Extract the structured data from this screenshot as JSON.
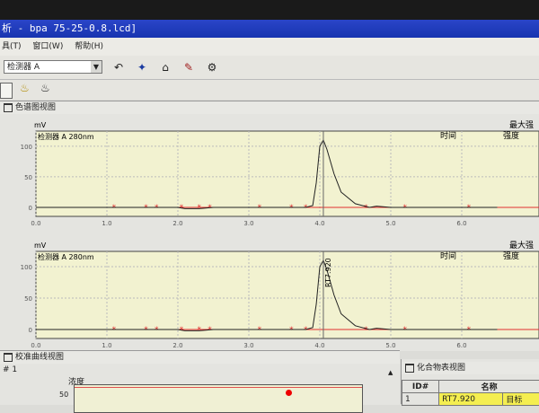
{
  "window": {
    "title": "析 - bpa 75-25-0.8.lcd]"
  },
  "menu": [
    "具(T)",
    "窗口(W)",
    "帮助(H)"
  ],
  "toolbar": {
    "detector_select": "检测器 A",
    "icons": [
      "undo-icon",
      "peak-icon",
      "integrate-icon",
      "edit-icon",
      "settings-icon"
    ]
  },
  "chromatogram_panel": {
    "title": "色谱图视图"
  },
  "charts": [
    {
      "detector_label": "检测器 A 280nm",
      "unit": "mV",
      "col_time": "时间",
      "col_intensity": "强度",
      "max_label": "最大强"
    },
    {
      "detector_label": "检测器 A 280nm",
      "unit": "mV",
      "col_time": "时间",
      "col_intensity": "强度",
      "max_label": "最大强",
      "peak_label": "RT7.920"
    }
  ],
  "chart_data": {
    "type": "line",
    "xlim": [
      0,
      6.5
    ],
    "ylim": [
      -5,
      125
    ],
    "xticks": [
      "0.0",
      "1.0",
      "2.0",
      "3.0",
      "4.0",
      "5.0",
      "6.0"
    ],
    "yticks": [
      "0",
      "50",
      "100"
    ],
    "ylabel": "mV",
    "grid": true,
    "x": [
      0,
      1,
      1.8,
      2.0,
      2.1,
      2.3,
      2.5,
      3.0,
      3.8,
      3.9,
      3.95,
      4.0,
      4.05,
      4.1,
      4.2,
      4.3,
      4.5,
      4.7,
      4.8,
      5.0,
      6.5
    ],
    "y": [
      0,
      0,
      0,
      0,
      -2,
      -2,
      0,
      0,
      0,
      3,
      40,
      100,
      110,
      95,
      55,
      25,
      6,
      0,
      2,
      0,
      0
    ],
    "marker_times": [
      1.1,
      1.55,
      1.7,
      2.05,
      2.3,
      2.45,
      3.15,
      3.6,
      3.8,
      4.65,
      5.2,
      6.1
    ]
  },
  "calibration_panel": {
    "title": "校准曲线视图",
    "id_label": "# 1",
    "y_axis": "浓度",
    "ytick": "50"
  },
  "compound_panel": {
    "title": "化合物表视图",
    "headers": [
      "ID#",
      "名称"
    ],
    "rows": [
      [
        "1",
        "RT7.920",
        "目标"
      ]
    ]
  }
}
